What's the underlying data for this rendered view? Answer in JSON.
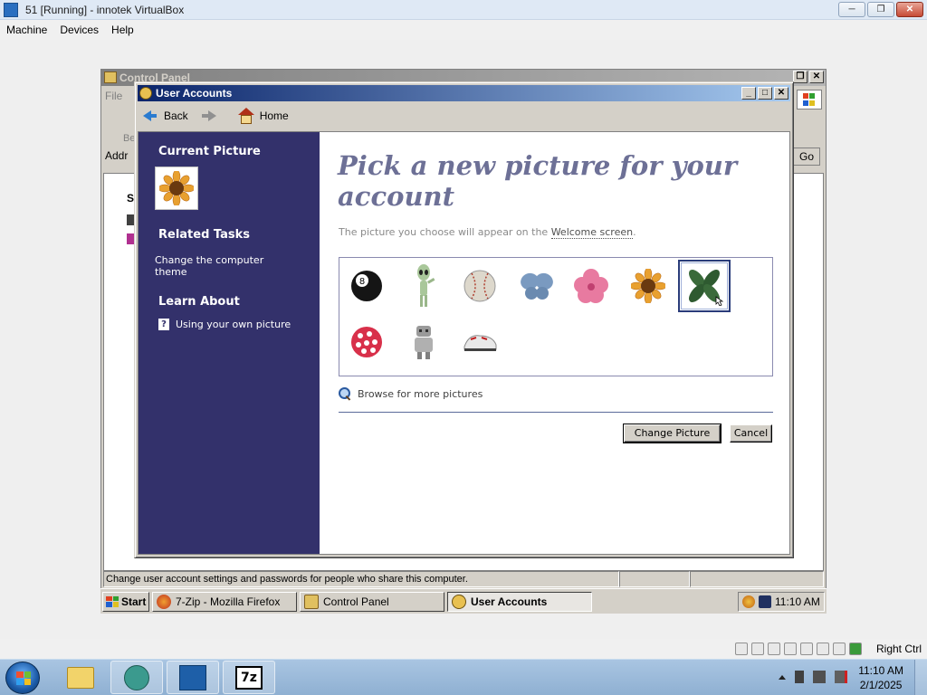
{
  "host": {
    "title": "51 [Running] - innotek VirtualBox",
    "menu": [
      "Machine",
      "Devices",
      "Help"
    ],
    "status_right": "Right Ctrl"
  },
  "control_panel": {
    "title": "Control Panel",
    "menu_fragment": "File",
    "toolbar_fragment": "Be",
    "address_fragment": "Addr",
    "go_label": "Go",
    "content_fragment": "S",
    "status_text": "Change user account settings and passwords for people who share this computer."
  },
  "user_accounts": {
    "title": "User Accounts",
    "nav": {
      "back": "Back",
      "home": "Home"
    },
    "sidebar": {
      "current_picture": "Current Picture",
      "related_tasks": "Related Tasks",
      "task_change_theme": "Change the computer theme",
      "learn_about": "Learn About",
      "learn_item": "Using your own picture"
    },
    "heading": "Pick a new picture for your account",
    "subtext_prefix": "The picture you choose will appear on the ",
    "subtext_link": "Welcome screen",
    "subtext_suffix": ".",
    "pictures": [
      "8-ball",
      "alien",
      "baseball",
      "butterfly",
      "flower",
      "sunflower",
      "leaves",
      "mushroom",
      "robot",
      "sneaker"
    ],
    "selected_picture": "leaves",
    "browse": "Browse for more pictures",
    "buttons": {
      "change": "Change Picture",
      "cancel": "Cancel"
    }
  },
  "guest_taskbar": {
    "start": "Start",
    "items": [
      "7-Zip - Mozilla Firefox",
      "Control Panel",
      "User Accounts"
    ],
    "active": "User Accounts",
    "clock": "11:10 AM"
  },
  "win7_taskbar": {
    "time": "11:10 AM",
    "date": "2/1/2025",
    "pinned": [
      "explorer",
      "dragon",
      "virtualbox",
      "7-zip"
    ],
    "sevenzip_label": "7z"
  }
}
